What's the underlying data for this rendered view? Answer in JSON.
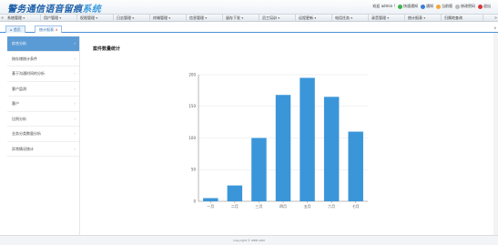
{
  "header": {
    "logo_main": "警务通信语音留痕",
    "logo_accent": "系统",
    "welcome": "欢迎 admin !",
    "links": [
      {
        "label": "快速通知",
        "color": "#3cb54a"
      },
      {
        "label": "通知",
        "color": "#3a7fd8"
      },
      {
        "label": "当前版",
        "color": "#f2a93b"
      },
      {
        "label": "修改密码",
        "color": "#bbbbbb"
      },
      {
        "label": "退出",
        "color": "#d9363e"
      }
    ]
  },
  "nav": {
    "left_arrow": "«",
    "right_arrow": "»",
    "items": [
      "系统管理",
      "用户管理",
      "权限管理",
      "日志管理",
      "终端管理",
      "信息管理",
      "留存下发",
      "员工培训",
      "远程更新",
      "电话任务",
      "录音管理",
      "统计报表",
      "归属地查询"
    ]
  },
  "tabs": [
    {
      "label": "首页",
      "icon": "home-icon"
    },
    {
      "label": "统计报表",
      "close": "x"
    }
  ],
  "tab_end_label": "x",
  "sidebar": {
    "items": [
      {
        "label": "综合分析",
        "active": true
      },
      {
        "label": "按存储统计条件",
        "active": false
      },
      {
        "label": "基于沟通时间的分析",
        "active": false
      },
      {
        "label": "客户监测",
        "active": false
      },
      {
        "label": "客户",
        "active": false
      },
      {
        "label": "比例分析",
        "active": false
      },
      {
        "label": "业务分类数量分析",
        "active": false
      },
      {
        "label": "异常情况统计",
        "active": false
      }
    ]
  },
  "chart_title": "案件数量统计",
  "chart_data": {
    "type": "bar",
    "categories": [
      "一月",
      "二月",
      "三月",
      "四月",
      "五月",
      "六月",
      "七月"
    ],
    "values": [
      5,
      25,
      100,
      168,
      195,
      165,
      110
    ],
    "ylim": [
      0,
      200
    ],
    "yticks": [
      0,
      50,
      100,
      150,
      200
    ],
    "grid": true,
    "bar_color": "#3a96d9"
  },
  "footer": {
    "copyright": "Copyright © WEB COM"
  }
}
